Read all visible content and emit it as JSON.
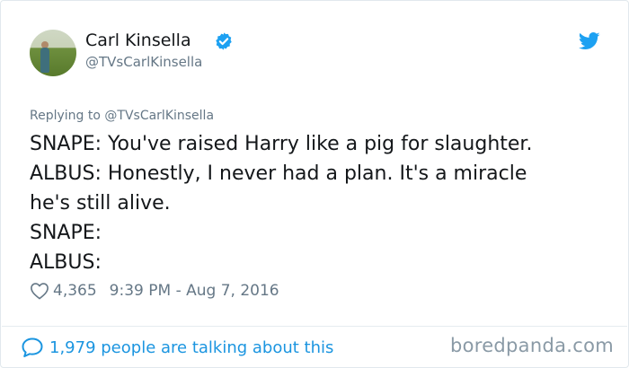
{
  "tweet": {
    "author_name": "Carl Kinsella",
    "author_handle": "@TVsCarlKinsella",
    "replying_prefix": "Replying to ",
    "replying_handle": "@TVsCarlKinsella",
    "body_lines": [
      "SNAPE: You've raised Harry like a pig for slaughter.",
      "ALBUS: Honestly, I never had a plan. It's a miracle",
      "he's still alive.",
      "SNAPE:",
      "ALBUS:"
    ],
    "likes": "4,365",
    "timestamp": "9:39 PM - Aug 7, 2016",
    "conversation_text": "1,979 people are talking about this"
  },
  "watermark": "boredpanda.com",
  "icons": {
    "verified": "verified-badge-icon",
    "brand": "twitter-bird-icon",
    "like": "heart-icon",
    "conversation": "speech-bubble-icon"
  },
  "colors": {
    "brand_blue": "#1da1f2",
    "link_blue": "#1b95e0",
    "muted_text": "#657786",
    "primary_text": "#14171a"
  }
}
